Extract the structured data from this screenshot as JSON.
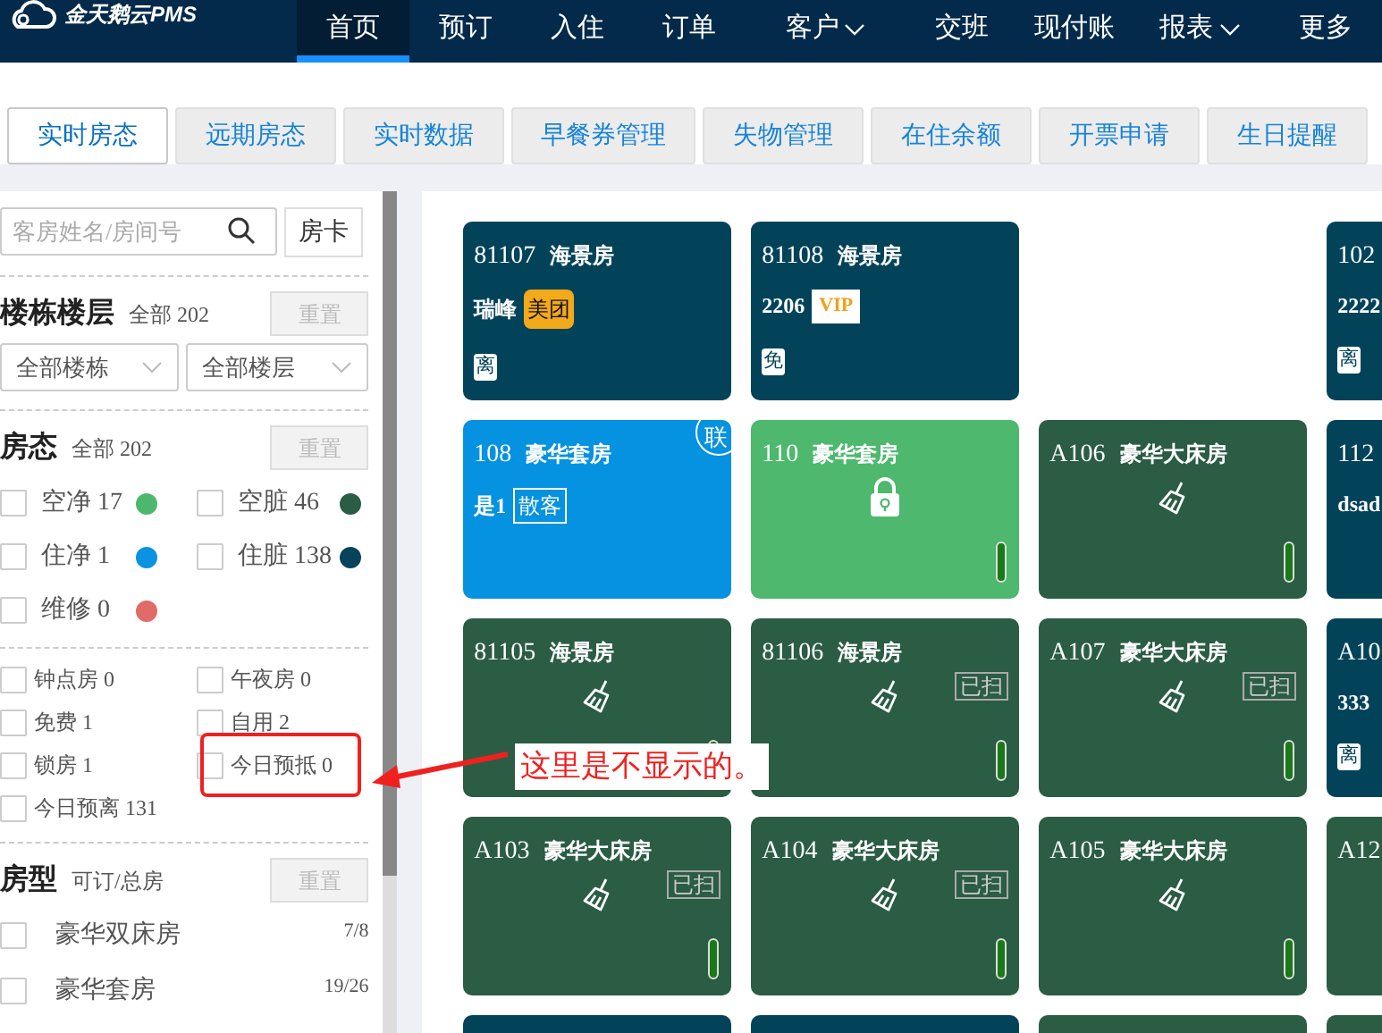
{
  "app": {
    "logo_text": "金天鹅云PMS"
  },
  "nav": [
    {
      "label": "首页",
      "selected": true,
      "dropdown": false
    },
    {
      "label": "预订",
      "selected": false,
      "dropdown": false
    },
    {
      "label": "入住",
      "selected": false,
      "dropdown": false
    },
    {
      "label": "订单",
      "selected": false,
      "dropdown": false
    },
    {
      "label": "客户",
      "selected": false,
      "dropdown": true
    },
    {
      "label": "交班",
      "selected": false,
      "dropdown": false
    },
    {
      "label": "现付账",
      "selected": false,
      "dropdown": false
    },
    {
      "label": "报表",
      "selected": false,
      "dropdown": true
    },
    {
      "label": "更多",
      "selected": false,
      "dropdown": false
    }
  ],
  "tabs": [
    {
      "label": "实时房态",
      "selected": true
    },
    {
      "label": "远期房态",
      "selected": false
    },
    {
      "label": "实时数据",
      "selected": false
    },
    {
      "label": "早餐券管理",
      "selected": false
    },
    {
      "label": "失物管理",
      "selected": false
    },
    {
      "label": "在住余额",
      "selected": false
    },
    {
      "label": "开票申请",
      "selected": false
    },
    {
      "label": "生日提醒",
      "selected": false
    }
  ],
  "sidebar": {
    "search": {
      "placeholder": "客房姓名/房间号"
    },
    "room_card_button": "房卡",
    "sections": [
      {
        "kind": "selects",
        "title": "楼栋楼层",
        "summary": "全部 202",
        "reset": {
          "label": "重置",
          "disabled": true
        },
        "selects": [
          "全部楼栋",
          "全部楼层"
        ]
      },
      {
        "kind": "status",
        "title": "房态",
        "summary": "全部 202",
        "reset": {
          "label": "重置",
          "disabled": true
        },
        "items": [
          {
            "label": "空净 17",
            "checked": false,
            "color": "#4cb86e"
          },
          {
            "label": "空脏 46",
            "checked": false,
            "color": "#2b5c44"
          },
          {
            "label": "住净 1",
            "checked": false,
            "color": "#0b92e0"
          },
          {
            "label": "住脏 138",
            "checked": false,
            "color": "#07435a"
          },
          {
            "label": "维修 0",
            "checked": false,
            "color": "#e06b68"
          }
        ]
      },
      {
        "kind": "flags",
        "items": [
          {
            "label": "钟点房 0",
            "checked": false,
            "highlighted": false
          },
          {
            "label": "午夜房 0",
            "checked": false,
            "highlighted": false
          },
          {
            "label": "免费 1",
            "checked": false,
            "highlighted": false
          },
          {
            "label": "自用 2",
            "checked": false,
            "highlighted": false
          },
          {
            "label": "锁房 1",
            "checked": false,
            "highlighted": false
          },
          {
            "label": "今日预抵 0",
            "checked": false,
            "highlighted": true
          },
          {
            "label": "今日预离 131",
            "checked": false,
            "highlighted": false
          }
        ]
      },
      {
        "kind": "room_types",
        "title": "房型",
        "summary": "可订/总房",
        "reset": {
          "label": "重置",
          "disabled": true
        },
        "items": [
          {
            "label": "豪华双床房",
            "count": "7/8",
            "checked": false
          },
          {
            "label": "豪华套房",
            "count": "19/26",
            "checked": false
          }
        ]
      }
    ]
  },
  "rooms": [
    {
      "kind": "occupied",
      "color": "#03435a",
      "number": "81107",
      "room_type": "海景房",
      "guest": "瑞峰",
      "guest_tag": {
        "kind": "channel",
        "text": "美团"
      },
      "badge": "离"
    },
    {
      "kind": "occupied",
      "color": "#03435a",
      "number": "81108",
      "room_type": "海景房",
      "guest": "2206",
      "guest_tag": {
        "kind": "vip",
        "text": "VIP"
      },
      "badge": "免"
    },
    {
      "kind": "empty"
    },
    {
      "kind": "partial",
      "color": "#03435a",
      "number": "102",
      "guest": "2222",
      "badge": "离"
    },
    {
      "kind": "occupied",
      "color": "#0592e0",
      "number": "108",
      "room_type": "豪华套房",
      "guest": "是1",
      "guest_tag": {
        "kind": "outline",
        "text": "散客"
      },
      "linked": "联"
    },
    {
      "kind": "locked",
      "color": "#4db86e",
      "number": "110",
      "room_type": "豪华套房",
      "indicator": true
    },
    {
      "kind": "cleaning",
      "color": "#2b5c44",
      "number": "A106",
      "room_type": "豪华大床房",
      "indicator": true
    },
    {
      "kind": "partial",
      "color": "#03435a",
      "number": "112",
      "guest": "dsad"
    },
    {
      "kind": "cleaning",
      "color": "#2b5c44",
      "number": "81105",
      "room_type": "海景房",
      "indicator": true
    },
    {
      "kind": "cleaning",
      "color": "#2b5c44",
      "number": "81106",
      "room_type": "海景房",
      "cleaned": "已扫",
      "indicator": true
    },
    {
      "kind": "cleaning",
      "color": "#2b5c44",
      "number": "A107",
      "room_type": "豪华大床房",
      "cleaned": "已扫",
      "indicator": true
    },
    {
      "kind": "partial",
      "color": "#03435a",
      "number": "A10",
      "guest": "333",
      "badge": "离"
    },
    {
      "kind": "cleaning",
      "color": "#2b5c44",
      "number": "A103",
      "room_type": "豪华大床房",
      "cleaned": "已扫",
      "indicator": true
    },
    {
      "kind": "cleaning",
      "color": "#2b5c44",
      "number": "A104",
      "room_type": "豪华大床房",
      "cleaned": "已扫",
      "indicator": true
    },
    {
      "kind": "cleaning",
      "color": "#2b5c44",
      "number": "A105",
      "room_type": "豪华大床房",
      "indicator": true
    },
    {
      "kind": "partial",
      "color": "#2b5c44",
      "number": "A12"
    },
    {
      "kind": "plain",
      "color": "#03435a"
    },
    {
      "kind": "plain",
      "color": "#03435a"
    },
    {
      "kind": "plain",
      "color": "#2b5c44"
    },
    {
      "kind": "partial",
      "color": "#2b5c44"
    }
  ],
  "annotation": {
    "text": "这里是不显示的。"
  }
}
